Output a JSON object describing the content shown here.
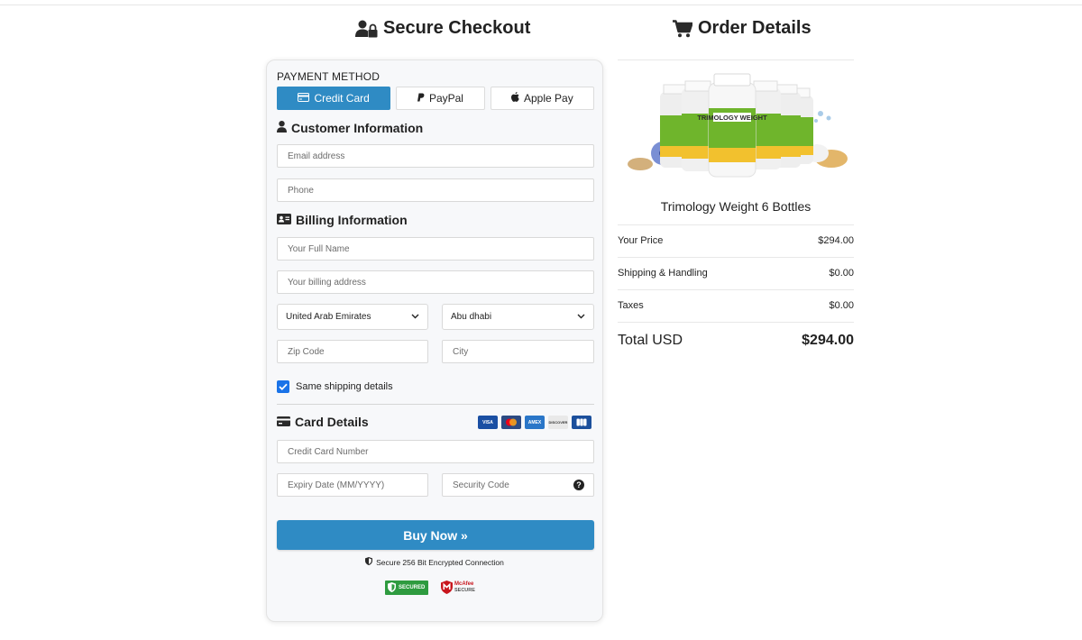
{
  "checkout": {
    "title": "Secure Checkout",
    "payment_method_label": "PAYMENT METHOD",
    "tabs": [
      {
        "label": "Credit Card",
        "active": true
      },
      {
        "label": "PayPal",
        "active": false
      },
      {
        "label": "Apple Pay",
        "active": false
      }
    ],
    "customer": {
      "title": "Customer Information",
      "email_placeholder": "Email address",
      "phone_placeholder": "Phone"
    },
    "billing": {
      "title": "Billing Information",
      "name_placeholder": "Your Full Name",
      "address_placeholder": "Your billing address",
      "country": "United Arab Emirates",
      "region": "Abu dhabi",
      "zip_placeholder": "Zip Code",
      "city_placeholder": "City",
      "same_shipping_label": "Same shipping details",
      "same_shipping_checked": true
    },
    "card": {
      "title": "Card Details",
      "card_brands": [
        "VISA",
        "Mastercard",
        "AMEX",
        "DISCOVER",
        "JCB"
      ],
      "number_placeholder": "Credit Card Number",
      "expiry_placeholder": "Expiry Date (MM/YYYY)",
      "cvc_placeholder": "Security Code"
    },
    "buy_button": "Buy Now »",
    "secure_text": "Secure 256 Bit Encrypted Connection",
    "trust_badges": {
      "ssl_line1": "SECURED",
      "mcafee_line1": "McAfee",
      "mcafee_line2": "SECURE"
    }
  },
  "order": {
    "title": "Order Details",
    "product_label": "TRIMOLOGY WEIGHT",
    "product_name": "Trimology Weight 6 Bottles",
    "rows": [
      {
        "label": "Your Price",
        "value": "$294.00"
      },
      {
        "label": "Shipping & Handling",
        "value": "$0.00"
      },
      {
        "label": "Taxes",
        "value": "$0.00"
      }
    ],
    "total_label": "Total USD",
    "total_value": "$294.00"
  },
  "colors": {
    "accent": "#2f8bc4",
    "checkbox": "#1a73e8"
  }
}
